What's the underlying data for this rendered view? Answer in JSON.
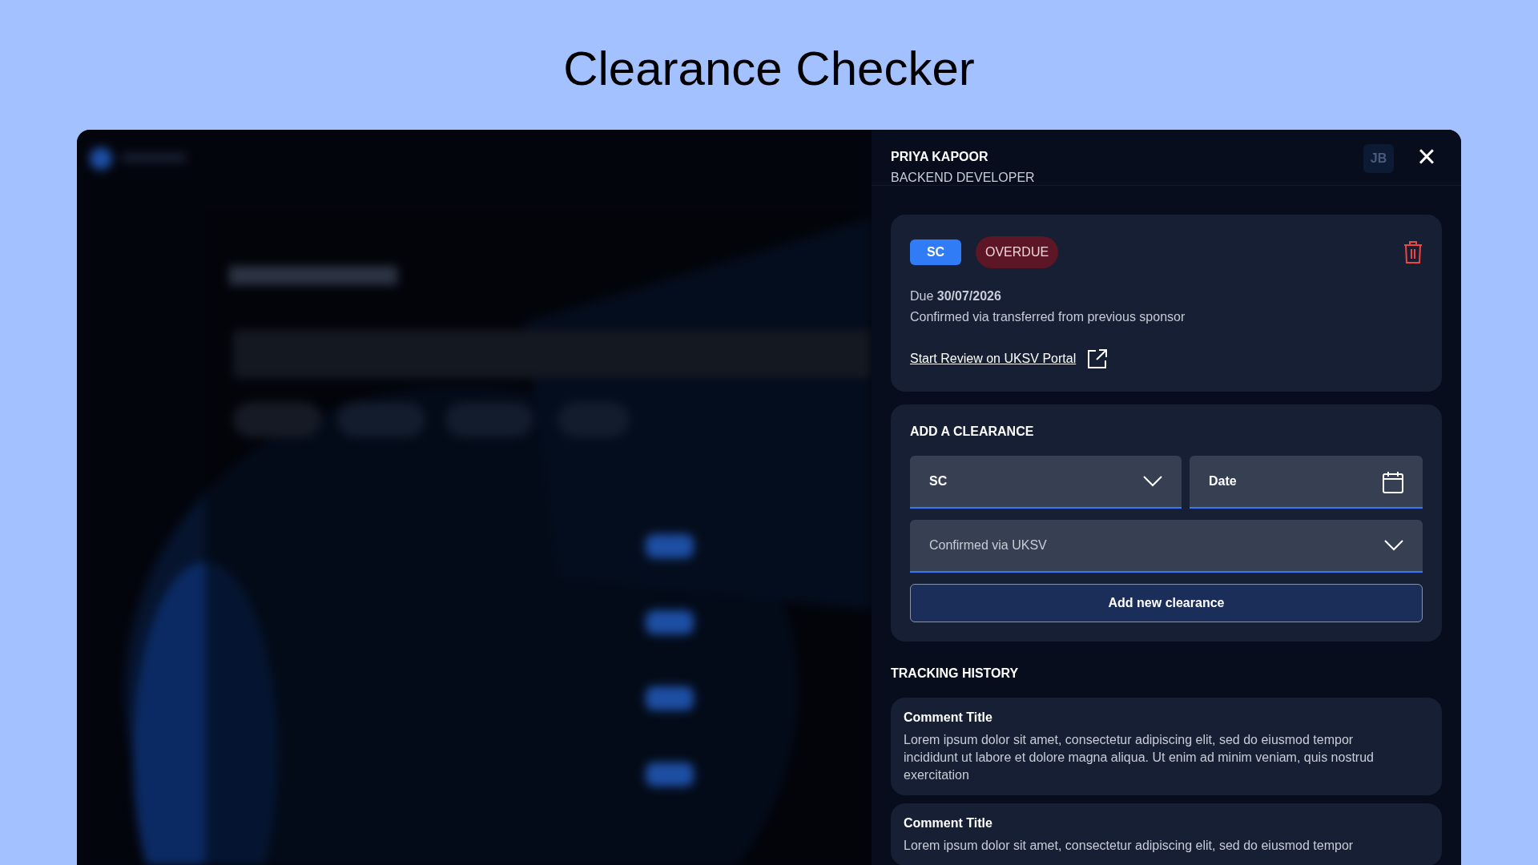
{
  "page_title": "Clearance Checker",
  "background_app": {
    "avatar_initials": "JB"
  },
  "panel": {
    "person_name": "PRIYA KAPOOR",
    "person_role": "BACKEND DEVELOPER",
    "close_icon": "×"
  },
  "clearance": {
    "level": "SC",
    "status": {
      "label": "OVERDUE",
      "kind": "overdue"
    },
    "due_label": "Due **30/07/2026**",
    "note": "Confirmed via transferred from previous sponsor",
    "link": "Start Review on UKSV Portal"
  },
  "add_clearance": {
    "heading": "ADD A CLEARANCE",
    "level_select": {
      "value": "SC"
    },
    "date_field": {
      "placeholder": "Date"
    },
    "method_select": {
      "value": "Confirmed via UKSV"
    },
    "button": "Add new clearance"
  },
  "tracking_history": {
    "heading": "TRACKING HISTORY",
    "comments": [
      {
        "title": "Comment Title",
        "body": "Lorem ipsum dolor sit amet, consectetur adipiscing elit, sed do eiusmod tempor incididunt ut labore et dolore magna aliqua. Ut enim ad minim veniam, quis nostrud exercitation"
      },
      {
        "title": "Comment Title",
        "body": "Lorem ipsum dolor sit amet, consectetur adipiscing elit, sed do eiusmod tempor"
      }
    ]
  }
}
